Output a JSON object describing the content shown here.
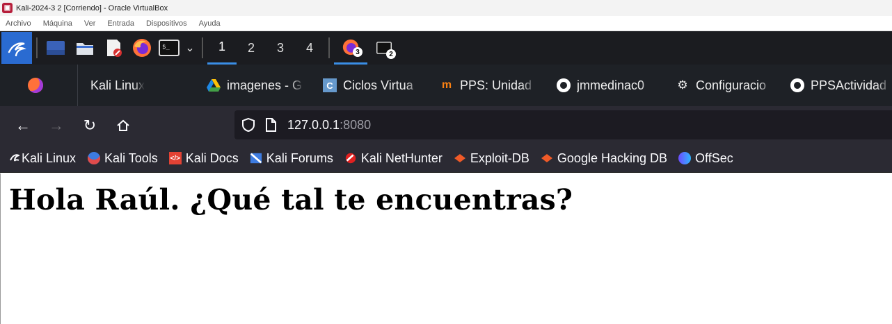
{
  "window": {
    "title": "Kali-2024-3 2 [Corriendo] - Oracle VirtualBox"
  },
  "vbox_menu": [
    "Archivo",
    "Máquina",
    "Ver",
    "Entrada",
    "Dispositivos",
    "Ayuda"
  ],
  "panel": {
    "workspaces": [
      "1",
      "2",
      "3",
      "4"
    ],
    "firefox_badge": "3",
    "terminal_badge": "2"
  },
  "tabs": [
    {
      "label": "Kali Linux",
      "icon": "firefox-icon"
    },
    {
      "label": "imagenes - G",
      "icon": "google-drive-icon"
    },
    {
      "label": "Ciclos Virtua",
      "icon": "moodle-icon"
    },
    {
      "label": "PPS: Unidad",
      "icon": "moodle-in-icon"
    },
    {
      "label": "jmmedinac0",
      "icon": "github-icon"
    },
    {
      "label": "Configuracio",
      "icon": "chatgpt-icon"
    },
    {
      "label": "PPSActividad",
      "icon": "github-icon"
    }
  ],
  "urlbar": {
    "host": "127.0.0.1",
    "port": ":8080"
  },
  "bookmarks": [
    {
      "label": "Kali Linux",
      "icon": "kali-dragon-icon"
    },
    {
      "label": "Kali Tools",
      "icon": "kali-tools-icon"
    },
    {
      "label": "Kali Docs",
      "icon": "kali-docs-icon"
    },
    {
      "label": "Kali Forums",
      "icon": "kali-forums-icon"
    },
    {
      "label": "Kali NetHunter",
      "icon": "nethunter-icon"
    },
    {
      "label": "Exploit-DB",
      "icon": "exploit-db-icon"
    },
    {
      "label": "Google Hacking DB",
      "icon": "ghdb-icon"
    },
    {
      "label": "OffSec",
      "icon": "offsec-icon"
    }
  ],
  "page": {
    "heading": "Hola Raúl. ¿Qué tal te encuentras?"
  },
  "colors": {
    "panel": "#1b1c20",
    "accent": "#3a8ee6",
    "kali_blue": "#2a6bd1",
    "toolbar": "#2b2a33"
  }
}
